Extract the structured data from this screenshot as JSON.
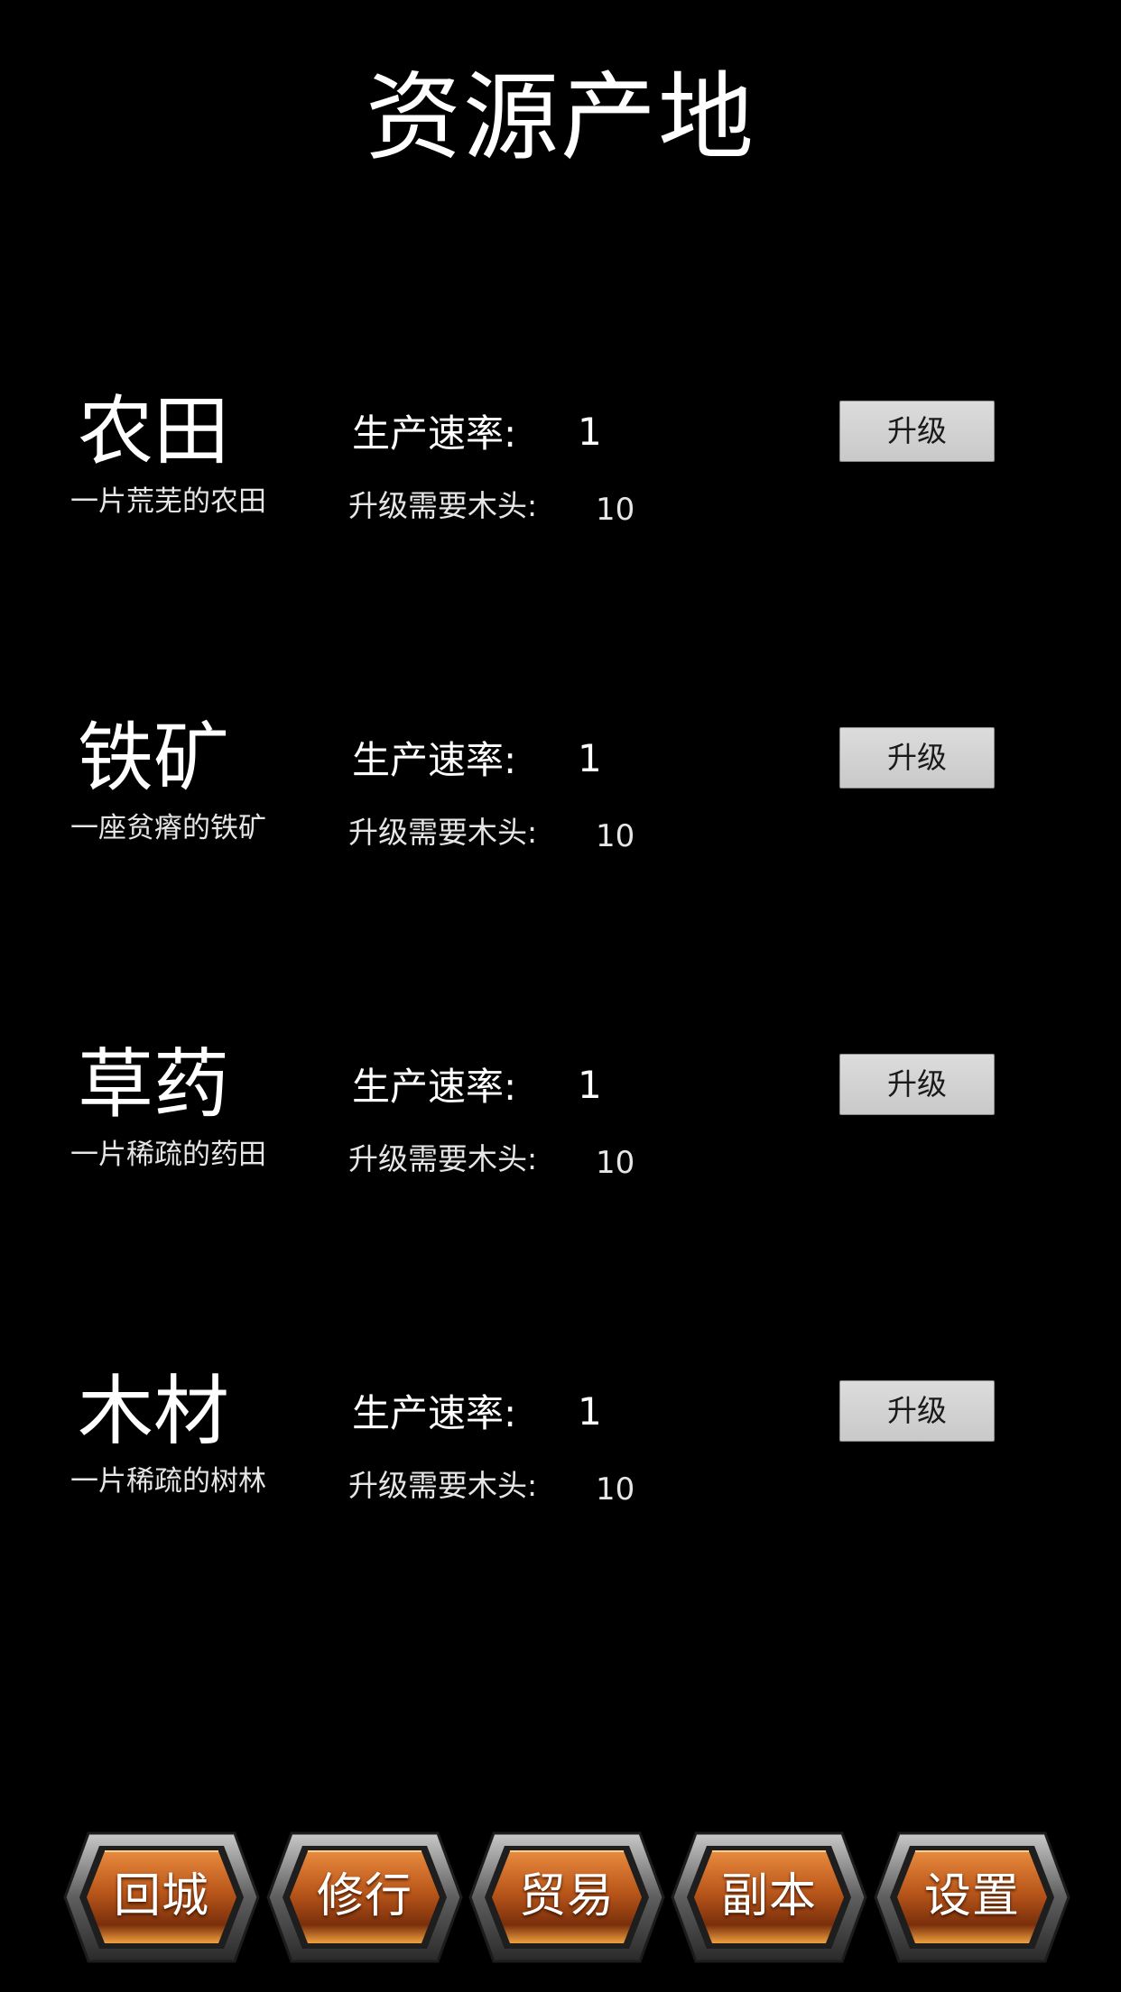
{
  "header": {
    "title": "资源产地"
  },
  "resources": [
    {
      "name": "农田",
      "description": "一片荒芜的农田",
      "rate_label": "生产速率:",
      "rate_value": "1",
      "cost_label": "升级需要木头:",
      "cost_value": "10",
      "upgrade_label": "升级"
    },
    {
      "name": "铁矿",
      "description": "一座贫瘠的铁矿",
      "rate_label": "生产速率:",
      "rate_value": "1",
      "cost_label": "升级需要木头:",
      "cost_value": "10",
      "upgrade_label": "升级"
    },
    {
      "name": "草药",
      "description": "一片稀疏的药田",
      "rate_label": "生产速率:",
      "rate_value": "1",
      "cost_label": "升级需要木头:",
      "cost_value": "10",
      "upgrade_label": "升级"
    },
    {
      "name": "木材",
      "description": "一片稀疏的树林",
      "rate_label": "生产速率:",
      "rate_value": "1",
      "cost_label": "升级需要木头:",
      "cost_value": "10",
      "upgrade_label": "升级"
    }
  ],
  "nav": {
    "items": [
      {
        "label": "回城"
      },
      {
        "label": "修行"
      },
      {
        "label": "贸易"
      },
      {
        "label": "副本"
      },
      {
        "label": "设置"
      }
    ]
  },
  "colors": {
    "background": "#000000",
    "text": "#ffffff",
    "button_face": "#d3d3d3",
    "nav_orange": "#c8621e",
    "nav_frame": "#8f8f8f"
  }
}
